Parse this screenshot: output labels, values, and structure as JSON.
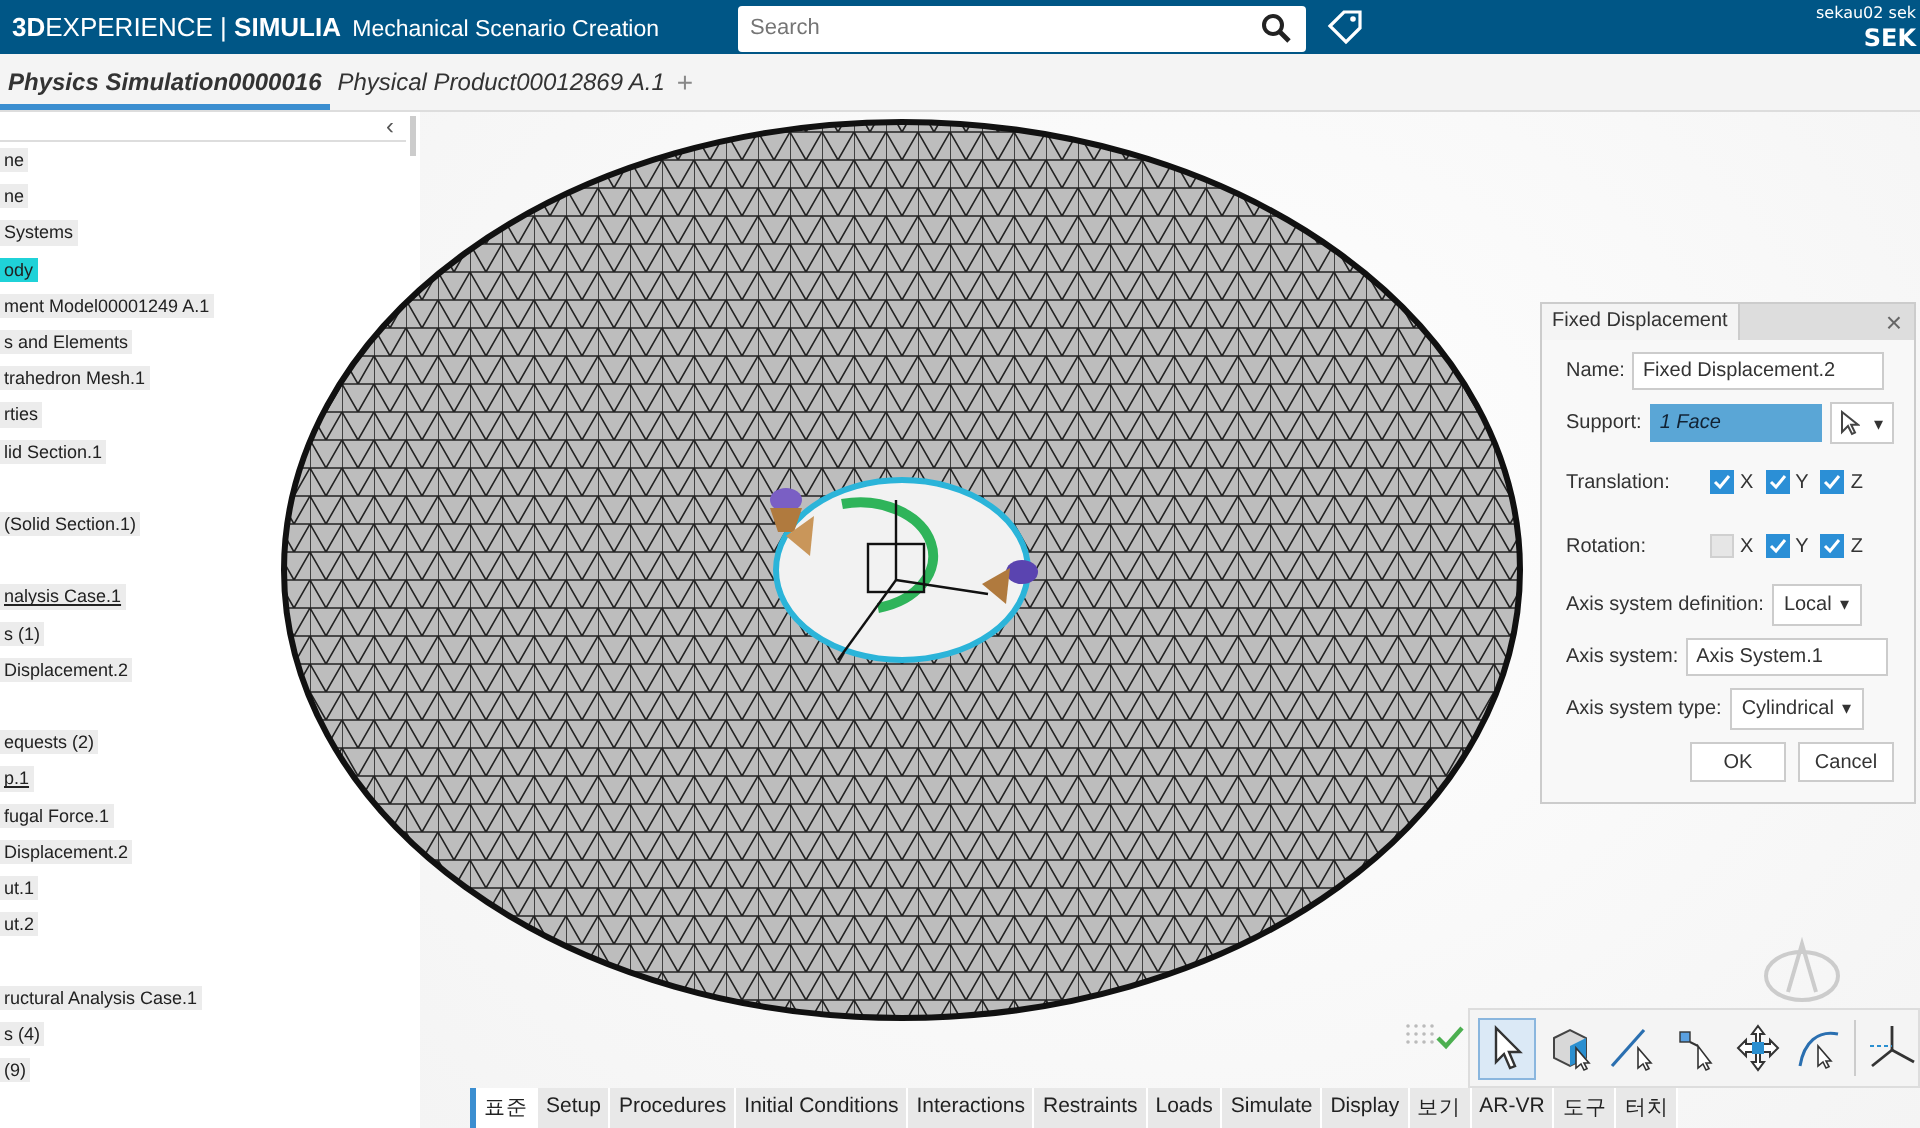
{
  "top_bar": {
    "brand_bold": "3D",
    "brand": "EXPERIENCE",
    "separator": "|",
    "product": "SIMULIA",
    "app": "Mechanical Scenario Creation",
    "search": {
      "placeholder": "Search"
    },
    "user_small": "sekau02 sek",
    "user": "SEK"
  },
  "doc_tabs": [
    {
      "label": "Physics Simulation0000016",
      "selected": true
    },
    {
      "label": "Physical Product00012869 A.1",
      "selected": false
    }
  ],
  "add_tab": "+",
  "tree": {
    "collapse": "‹",
    "items": [
      {
        "label": "ne",
        "selected": false,
        "underlined": false,
        "gap_before": false
      },
      {
        "label": "ne",
        "selected": false,
        "underlined": false,
        "gap_before": false
      },
      {
        "label": "Systems",
        "selected": false,
        "underlined": false,
        "gap_before": false
      },
      {
        "label": "ody",
        "selected": true,
        "underlined": false,
        "gap_before": false
      },
      {
        "label": "ment Model00001249 A.1",
        "selected": false,
        "underlined": false,
        "gap_before": false
      },
      {
        "label": "s and Elements",
        "selected": false,
        "underlined": false,
        "gap_before": false
      },
      {
        "label": "trahedron Mesh.1",
        "selected": false,
        "underlined": false,
        "gap_before": false
      },
      {
        "label": "rties",
        "selected": false,
        "underlined": false,
        "gap_before": false
      },
      {
        "label": "lid Section.1",
        "selected": false,
        "underlined": false,
        "gap_before": false
      },
      {
        "label": "(Solid Section.1)",
        "selected": false,
        "underlined": false,
        "gap_before": true
      },
      {
        "label": "nalysis Case.1",
        "selected": false,
        "underlined": true,
        "gap_before": true
      },
      {
        "label": "s (1)",
        "selected": false,
        "underlined": false,
        "gap_before": false
      },
      {
        "label": "Displacement.2",
        "selected": false,
        "underlined": false,
        "gap_before": false
      },
      {
        "label": "equests (2)",
        "selected": false,
        "underlined": false,
        "gap_before": true
      },
      {
        "label": "p.1",
        "selected": false,
        "underlined": true,
        "gap_before": false
      },
      {
        "label": "fugal Force.1",
        "selected": false,
        "underlined": false,
        "gap_before": false
      },
      {
        "label": "Displacement.2",
        "selected": false,
        "underlined": false,
        "gap_before": false
      },
      {
        "label": "ut.1",
        "selected": false,
        "underlined": false,
        "gap_before": false
      },
      {
        "label": "ut.2",
        "selected": false,
        "underlined": false,
        "gap_before": false
      },
      {
        "label": "ructural Analysis Case.1",
        "selected": false,
        "underlined": false,
        "gap_before": true
      },
      {
        "label": "s (4)",
        "selected": false,
        "underlined": false,
        "gap_before": false
      },
      {
        "label": "(9)",
        "selected": false,
        "underlined": false,
        "gap_before": false
      }
    ]
  },
  "dialog": {
    "title": "Fixed Displacement",
    "close": "×",
    "name": {
      "label": "Name:",
      "value": "Fixed Displacement.2"
    },
    "support": {
      "label": "Support:",
      "value": "1 Face",
      "caret": "▾"
    },
    "translation": {
      "label": "Translation:",
      "axes": [
        {
          "label": "X",
          "checked": true
        },
        {
          "label": "Y",
          "checked": true
        },
        {
          "label": "Z",
          "checked": true
        }
      ]
    },
    "rotation": {
      "label": "Rotation:",
      "axes": [
        {
          "label": "X",
          "checked": false
        },
        {
          "label": "Y",
          "checked": true
        },
        {
          "label": "Z",
          "checked": true
        }
      ]
    },
    "axis_definition": {
      "label": "Axis system definition:",
      "value": "Local",
      "caret": "▾"
    },
    "axis_system": {
      "label": "Axis system:",
      "value": "Axis System.1"
    },
    "axis_type": {
      "label": "Axis system type:",
      "value": "Cylindrical",
      "caret": "▾"
    },
    "buttons": [
      "OK",
      "Cancel"
    ]
  },
  "tools": [
    {
      "kind": "select",
      "selected": true
    },
    {
      "kind": "cube",
      "selected": false
    },
    {
      "kind": "line",
      "selected": false
    },
    {
      "kind": "point",
      "selected": false
    },
    {
      "kind": "move",
      "selected": false
    },
    {
      "kind": "arc",
      "selected": false
    },
    {
      "kind": "axis",
      "selected": false
    }
  ],
  "section_tabs": [
    {
      "label": "표준",
      "selected": true
    },
    {
      "label": "Setup",
      "selected": false
    },
    {
      "label": "Procedures",
      "selected": false
    },
    {
      "label": "Initial Conditions",
      "selected": false
    },
    {
      "label": "Interactions",
      "selected": false
    },
    {
      "label": "Restraints",
      "selected": false
    },
    {
      "label": "Loads",
      "selected": false
    },
    {
      "label": "Simulate",
      "selected": false
    },
    {
      "label": "Display",
      "selected": false
    },
    {
      "label": "보기",
      "selected": false
    },
    {
      "label": "AR-VR",
      "selected": false
    },
    {
      "label": "도구",
      "selected": false
    },
    {
      "label": "터치",
      "selected": false
    }
  ]
}
